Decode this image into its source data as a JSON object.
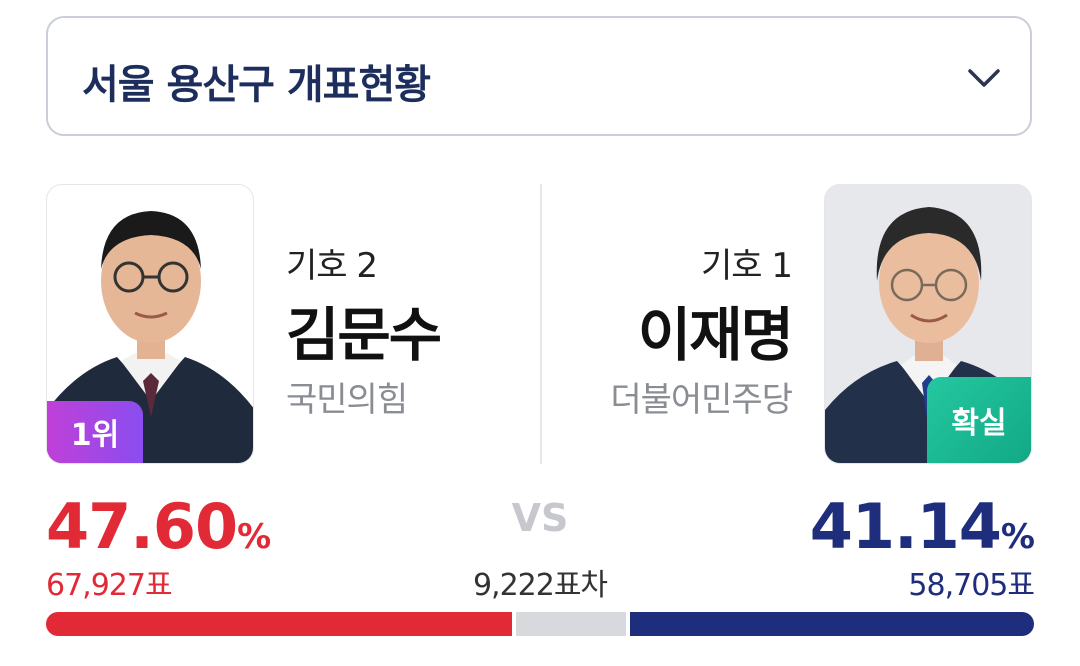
{
  "header": {
    "title": "서울 용산구 개표현황",
    "dropdown_icon": "chevron-down-icon"
  },
  "candidates": [
    {
      "number_label": "기호 2",
      "name": "김문수",
      "party": "국민의힘",
      "badge": "1위",
      "percent": "47.60",
      "percent_unit": "%",
      "votes": "67,927표",
      "color": "#e12a36"
    },
    {
      "number_label": "기호 1",
      "name": "이재명",
      "party": "더불어민주당",
      "badge": "확실",
      "percent": "41.14",
      "percent_unit": "%",
      "votes": "58,705표",
      "color": "#1e2d7c"
    }
  ],
  "vs_label": "VS",
  "difference": "9,222표차",
  "bar": {
    "left_share": 0.476,
    "right_share": 0.4114,
    "other_share": 0.1126,
    "colors": {
      "left": "#e12a36",
      "other": "#d8d9dc",
      "right": "#1e2d7c"
    }
  }
}
